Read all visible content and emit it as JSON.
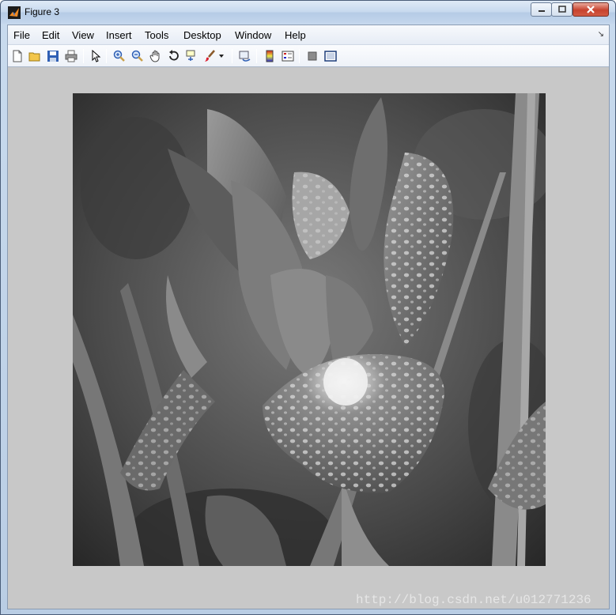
{
  "window": {
    "title": "Figure 3"
  },
  "menu": [
    {
      "label": "File"
    },
    {
      "label": "Edit"
    },
    {
      "label": "View"
    },
    {
      "label": "Insert"
    },
    {
      "label": "Tools"
    },
    {
      "label": "Desktop"
    },
    {
      "label": "Window"
    },
    {
      "label": "Help"
    }
  ],
  "toolbar": [
    "new-figure-icon",
    "open-file-icon",
    "save-icon",
    "print-icon",
    "edit-plot-arrow-icon",
    "zoom-in-icon",
    "zoom-out-icon",
    "pan-hand-icon",
    "rotate-3d-icon",
    "data-cursor-icon",
    "brush-icon",
    "link-plot-icon",
    "insert-colorbar-icon",
    "insert-legend-icon",
    "hide-plot-tools-icon",
    "show-plot-tools-icon"
  ],
  "image": {
    "subject": "grayscale iris flower with water droplets"
  },
  "watermark": "http://blog.csdn.net/u012771236"
}
